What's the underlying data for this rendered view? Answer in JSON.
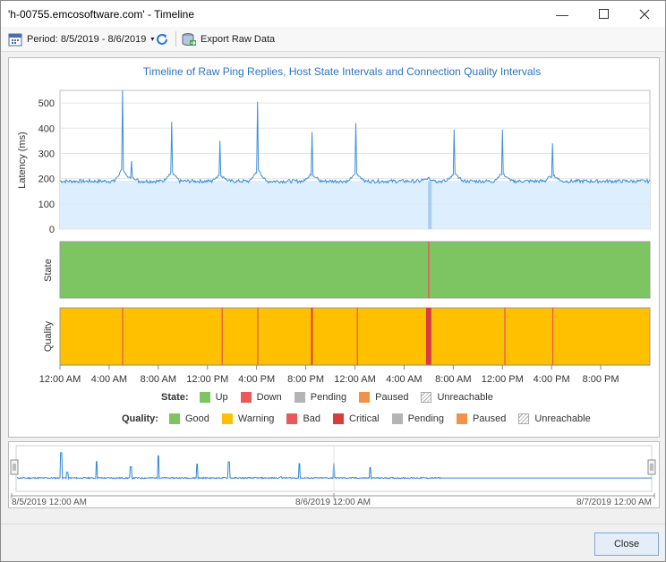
{
  "window": {
    "title": "'h-00755.emcosoftware.com' - Timeline"
  },
  "toolbar": {
    "period_label": "Period: 8/5/2019 - 8/6/2019",
    "export_label": "Export Raw Data"
  },
  "chart_title": "Timeline of Raw Ping Replies, Host State Intervals and Connection Quality Intervals",
  "axes": {
    "latency_label": "Latency (ms)",
    "state_label": "State",
    "quality_label": "Quality",
    "y_ticks": [
      "500",
      "400",
      "300",
      "200",
      "100",
      "0"
    ],
    "x_ticks": [
      "12:00 AM",
      "4:00 AM",
      "8:00 AM",
      "12:00 PM",
      "4:00 PM",
      "8:00 PM",
      "12:00 AM",
      "4:00 AM",
      "8:00 AM",
      "12:00 PM",
      "4:00 PM",
      "8:00 PM"
    ]
  },
  "legend": {
    "state_title": "State:",
    "state_items": [
      {
        "label": "Up",
        "color": "#7dc462"
      },
      {
        "label": "Down",
        "color": "#e85a5a"
      },
      {
        "label": "Pending",
        "color": "#b4b4b4"
      },
      {
        "label": "Paused",
        "color": "#f0924a"
      },
      {
        "label": "Unreachable",
        "color": "hatch"
      }
    ],
    "quality_title": "Quality:",
    "quality_items": [
      {
        "label": "Good",
        "color": "#7dc462"
      },
      {
        "label": "Warning",
        "color": "#ffc000"
      },
      {
        "label": "Bad",
        "color": "#e85a5a"
      },
      {
        "label": "Critical",
        "color": "#d83c3c"
      },
      {
        "label": "Pending",
        "color": "#b4b4b4"
      },
      {
        "label": "Paused",
        "color": "#f0924a"
      },
      {
        "label": "Unreachable",
        "color": "hatch"
      }
    ]
  },
  "overview": {
    "start_label": "8/5/2019 12:00 AM",
    "mid_label": "8/6/2019 12:00 AM",
    "end_label": "8/7/2019 12:00 AM"
  },
  "buttons": {
    "close_label": "Close"
  },
  "chart_data": {
    "type": "line",
    "ylabel": "Latency (ms)",
    "ylim": [
      0,
      550
    ],
    "x_range_hours": [
      0,
      48
    ],
    "baseline": 190,
    "spikes": [
      {
        "hour": 5.1,
        "value": 550
      },
      {
        "hour": 5.8,
        "value": 270
      },
      {
        "hour": 9.1,
        "value": 425
      },
      {
        "hour": 13.0,
        "value": 350
      },
      {
        "hour": 16.1,
        "value": 505
      },
      {
        "hour": 20.5,
        "value": 385
      },
      {
        "hour": 24.1,
        "value": 420
      },
      {
        "hour": 30.0,
        "value": 205
      },
      {
        "hour": 32.1,
        "value": 395
      },
      {
        "hour": 36.0,
        "value": 395
      },
      {
        "hour": 40.1,
        "value": 340
      }
    ],
    "state_intervals": [
      {
        "from_hour": 0,
        "to_hour": 29.95,
        "state": "Up"
      },
      {
        "from_hour": 29.95,
        "to_hour": 30.05,
        "state": "Down"
      },
      {
        "from_hour": 30.05,
        "to_hour": 48,
        "state": "Up"
      }
    ],
    "quality_intervals": [
      {
        "from_hour": 0,
        "to_hour": 48,
        "quality": "Warning"
      }
    ],
    "quality_markers": [
      {
        "hour": 5.1,
        "quality": "Bad"
      },
      {
        "hour": 13.2,
        "quality": "Bad"
      },
      {
        "hour": 16.1,
        "quality": "Bad"
      },
      {
        "hour": 20.5,
        "quality": "Critical"
      },
      {
        "hour": 24.2,
        "quality": "Bad"
      },
      {
        "hour": 30.0,
        "quality": "Critical"
      },
      {
        "hour": 36.2,
        "quality": "Bad"
      },
      {
        "hour": 40.1,
        "quality": "Bad"
      }
    ]
  }
}
